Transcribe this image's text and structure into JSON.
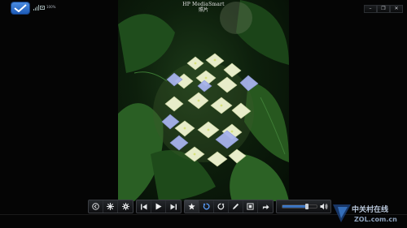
{
  "app": {
    "title": "HP MediaSmart",
    "section": "照片"
  },
  "status": {
    "battery_text": "100%"
  },
  "window_controls": [
    {
      "name": "minimize",
      "glyph": "–"
    },
    {
      "name": "restore",
      "glyph": "❐"
    },
    {
      "name": "close",
      "glyph": "✕"
    }
  ],
  "toolbar": {
    "groups": [
      [
        {
          "icon": "back-icon"
        },
        {
          "icon": "effects-icon"
        },
        {
          "icon": "settings-icon"
        }
      ],
      [
        {
          "icon": "previous-icon"
        },
        {
          "icon": "play-icon"
        },
        {
          "icon": "next-icon"
        }
      ],
      [
        {
          "icon": "favorite-star-icon"
        },
        {
          "icon": "rotate-left-icon"
        },
        {
          "icon": "rotate-right-icon"
        },
        {
          "icon": "edit-pen-icon"
        },
        {
          "icon": "fit-screen-icon"
        },
        {
          "icon": "share-icon"
        }
      ]
    ],
    "volume": {
      "level": 0.72,
      "icon": "speaker-icon"
    }
  },
  "watermark": {
    "text_cn": "中关村在线",
    "url": "ZOL.com.cn"
  },
  "colors": {
    "accent": "#2f6fd0",
    "background": "#050505"
  }
}
